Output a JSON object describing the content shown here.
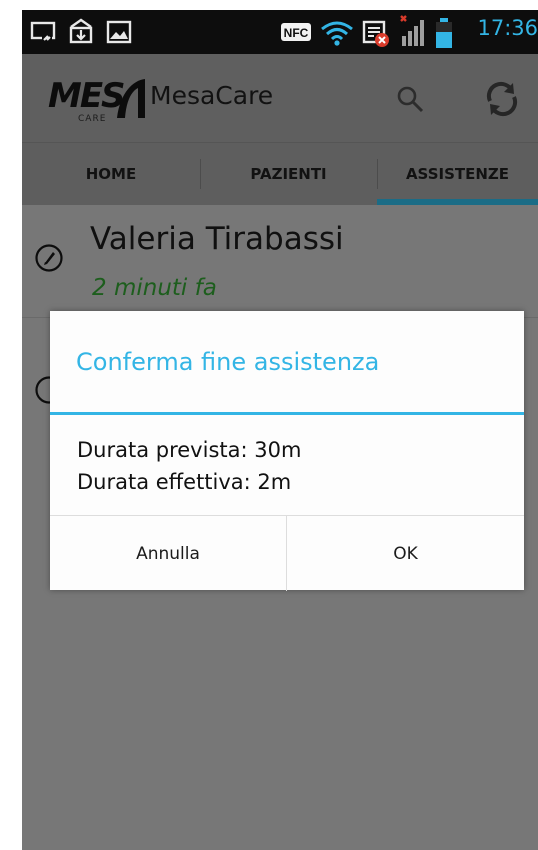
{
  "status_bar": {
    "time": "17:36",
    "nfc_label": "NFC",
    "icons": [
      "cast-icon",
      "sim-manager-icon",
      "gallery-icon",
      "nfc-icon",
      "wifi-icon",
      "sms-error-icon",
      "signal-icon",
      "battery-icon"
    ],
    "accent": "#33b5e5"
  },
  "action_bar": {
    "logo_text": "MES",
    "logo_sub": "CARE",
    "title": "MesaCare",
    "icons": [
      "search-icon",
      "refresh-icon"
    ]
  },
  "tabs": [
    {
      "label": "HOME"
    },
    {
      "label": "PAZIENTI"
    },
    {
      "label": "ASSISTENZE"
    }
  ],
  "selected_tab": "ASSISTENZE",
  "list": {
    "items": [
      {
        "name": "Valeria Tirabassi",
        "time": "2 minuti fa",
        "icon": "edit-icon"
      }
    ]
  },
  "dialog": {
    "title": "Conferma fine assistenza",
    "line1": "Durata prevista: 30m",
    "line2": "Durata effettiva: 2m",
    "cancel_label": "Annulla",
    "ok_label": "OK"
  },
  "colors": {
    "holo_blue": "#33b5e5",
    "tab_indicator": "#1b6c86",
    "time_green": "#1d5e1d"
  }
}
